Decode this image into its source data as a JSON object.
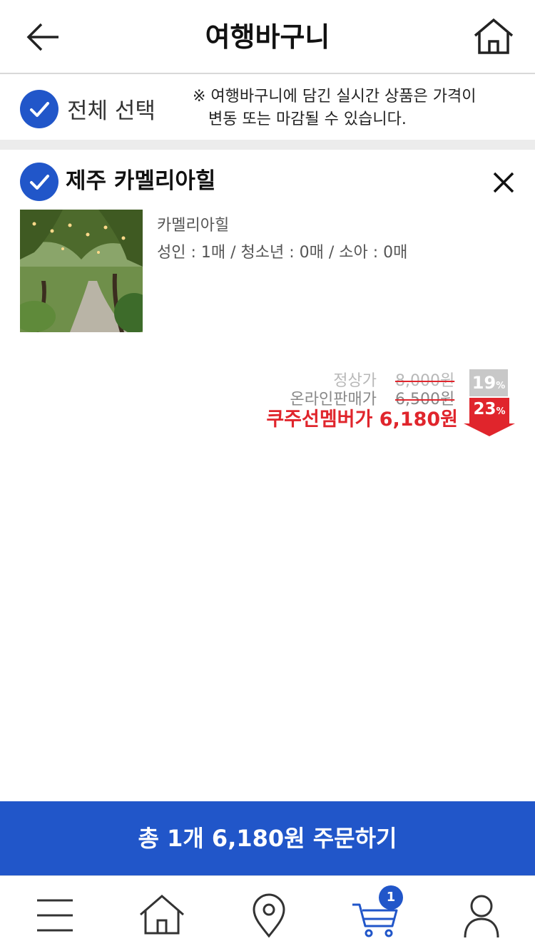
{
  "header": {
    "title": "여행바구니"
  },
  "select_all": {
    "label": "전체 선택",
    "checked": true,
    "notice_line1": "※ 여행바구니에 담긴 실시간 상품은 가격이",
    "notice_line2": "변동 또는 마감될 수 있습니다."
  },
  "item": {
    "name": "제주 카멜리아힐",
    "checked": true,
    "subtitle": "카멜리아힐",
    "quantity": "성인 : 1매 / 청소년 : 0매 / 소아 : 0매",
    "normal_price_label": "정상가",
    "normal_price": "8,000원",
    "online_price_label": "온라인판매가",
    "online_price": "6,500원",
    "member_price": "쿠주선멤버가 6,180원",
    "discount_grey": "19",
    "discount_red": "23",
    "percent_sign": "%"
  },
  "order_button": {
    "label": "총 1개 6,180원 주문하기"
  },
  "bottom_nav": {
    "cart_count": "1"
  },
  "colors": {
    "primary": "#2156c9",
    "member_price": "#e0252c",
    "discount_grey": "#c8c8c8"
  }
}
